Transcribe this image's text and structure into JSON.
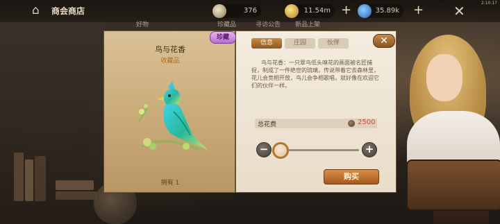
{
  "topbar": {
    "title": "商会商店",
    "resources": [
      {
        "icon": "medal-icon",
        "value": "376"
      },
      {
        "icon": "gold-coin-icon",
        "value": "11.54m"
      },
      {
        "icon": "gem-icon",
        "value": "35.89k"
      }
    ],
    "clock": "2:10:17",
    "tabs_behind": [
      "好物",
      "珍藏品",
      "寻访公告",
      "新品上架"
    ]
  },
  "item": {
    "rarity": "珍藏",
    "name": "鸟与花香",
    "type": "收藏品",
    "owned": "拥有 1"
  },
  "info": {
    "tabs": [
      "信息",
      "庄园",
      "伙伴"
    ],
    "description": "鸟与花香：一只翠鸟低头嗅花的画面被名匠捕捉，制成了一件绝世的琉璃，传说带着它去森林里，花儿会竞相开放，鸟儿会争相歌唱，就好像在欢迎它们的伙伴一样。",
    "cost_label": "总花费",
    "cost_value": "2500",
    "buy_label": "购买"
  },
  "colors": {
    "accent": "#c58a44",
    "price": "#c24a3c",
    "rarity": "#b56fcc"
  }
}
